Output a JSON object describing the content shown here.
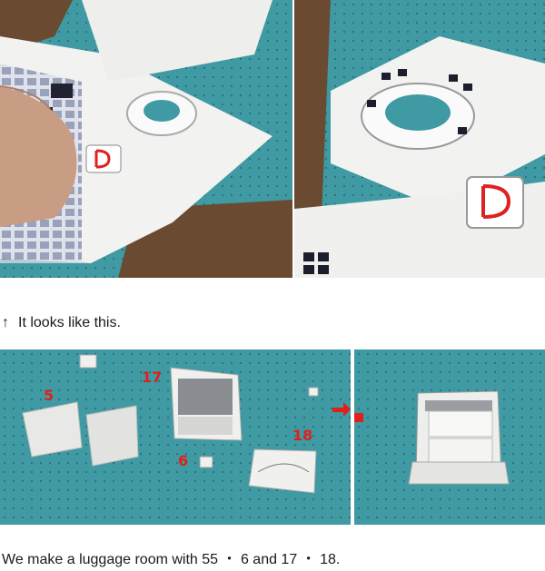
{
  "captions": {
    "first_arrow": "↑",
    "first_text": "It looks like this.",
    "second_text": "We make a luggage room with 55 ・ 6 and 17 ・ 18."
  },
  "photos": {
    "top_left": "paper-model-base-with-ring-photo",
    "top_right": "paper-model-ring-closeup-photo",
    "bottom_left": "luggage-parts-photo",
    "bottom_right": "assembled-luggage-room-photo"
  },
  "part_labels": {
    "p5": "5",
    "p17": "17",
    "p6": "6",
    "p18": "18"
  },
  "colors": {
    "cutting_mat": "#3f9aa3",
    "table": "#6b4a32",
    "paper": "#f2f2f0",
    "label_red": "#e0201a"
  }
}
